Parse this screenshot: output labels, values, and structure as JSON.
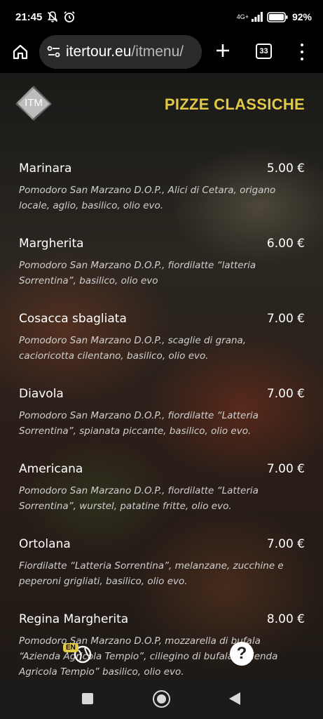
{
  "status_bar": {
    "time": "21:45",
    "network": "4G+",
    "battery": "92%"
  },
  "browser": {
    "url_domain": "itertour.eu",
    "url_path": "/itmenu/",
    "tab_count": "33"
  },
  "page": {
    "logo_text": "ITM",
    "section_title": "PIZZE CLASSICHE",
    "items": [
      {
        "name": "Marinara",
        "price": "5.00 €",
        "description": "Pomodoro San Marzano D.O.P., Alici di Cetara, origano locale, aglio, basilico, olio evo."
      },
      {
        "name": "Margherita",
        "price": "6.00 €",
        "description": "Pomodoro San Marzano D.O.P., fiordilatte “latteria Sorrentina”, basilico, olio evo"
      },
      {
        "name": "Cosacca sbagliata",
        "price": "7.00 €",
        "description": "Pomodoro San Marzano D.O.P., scaglie di grana, cacioricotta cilentano, basilico, olio evo."
      },
      {
        "name": "Diavola",
        "price": "7.00 €",
        "description": "Pomodoro San Marzano D.O.P., fiordilatte “Latteria Sorrentina”, spianata piccante, basilico, olio evo."
      },
      {
        "name": "Americana",
        "price": "7.00 €",
        "description": "Pomodoro San Marzano D.O.P., fiordilatte “Latteria Sorrentina”, wurstel, patatine fritte, olio evo."
      },
      {
        "name": "Ortolana",
        "price": "7.00 €",
        "description": "Fiordilatte “Latteria Sorrentina”, melanzane, zucchine e peperoni grigliati, basilico, olio evo."
      },
      {
        "name": "Regina Margherita",
        "price": "8.00 €",
        "description": "Pomodoro San Marzano D.O.P, mozzarella di bufala “Azienda Agricola Tempio”, ciliegino di bufala “Azienda Agricola Tempio” basilico, olio evo."
      }
    ],
    "language_badge": "EN",
    "help_symbol": "?"
  },
  "colors": {
    "accent": "#e2c944",
    "url_bar": "#2b2b2b",
    "nav_bar": "#1b1b1b"
  }
}
